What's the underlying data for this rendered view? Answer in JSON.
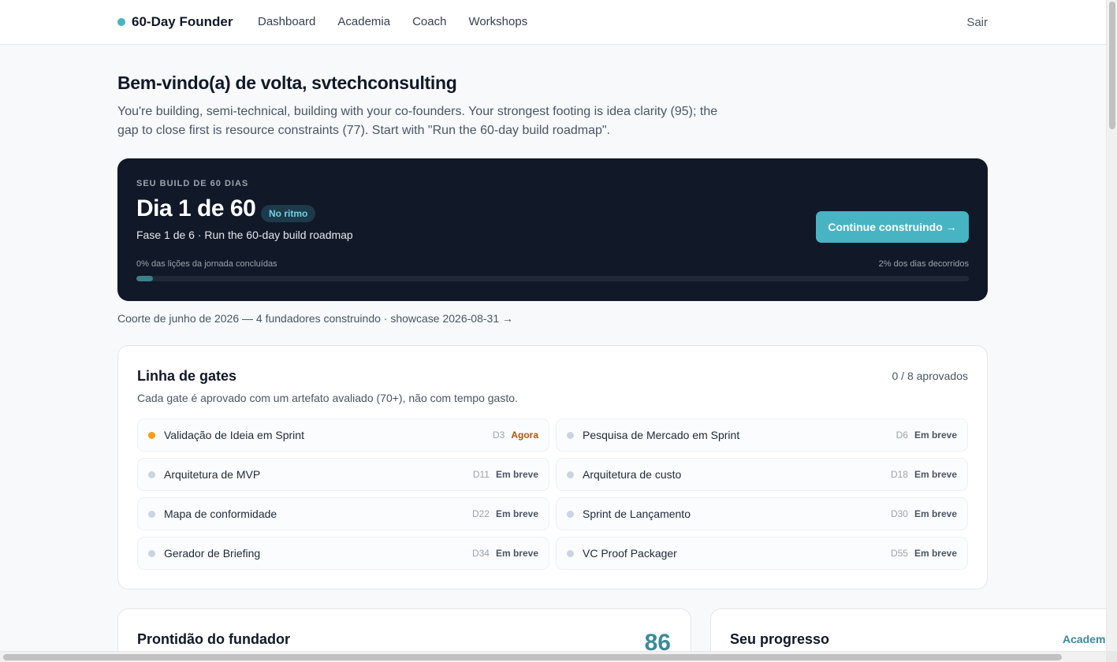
{
  "nav": {
    "brand": "60-Day Founder",
    "links": [
      "Dashboard",
      "Academia",
      "Coach",
      "Workshops"
    ],
    "logout": "Sair"
  },
  "welcome": {
    "title": "Bem-vindo(a) de volta, svtechconsulting",
    "text": "You're building, semi-technical, building with your co-founders. Your strongest footing is idea clarity (95); the gap to close first is resource constraints (77). Start with \"Run the 60-day build roadmap\"."
  },
  "build": {
    "eyebrow": "SEU BUILD DE 60 DIAS",
    "day": "Dia 1 de 60",
    "badge": "No ritmo",
    "phase": "Fase 1 de 6 · Run the 60-day build roadmap",
    "cta": "Continue construindo →",
    "lessons_progress": "0% das lições da jornada concluídas",
    "days_progress": "2% dos dias decorridos",
    "days_elapsed_fraction": 0.02
  },
  "cohort": "Coorte de junho de 2026 — 4 fundadores construindo · showcase 2026-08-31 →",
  "gates": {
    "title": "Linha de gates",
    "count": "0 / 8 aprovados",
    "subtitle": "Cada gate é aprovado com um artefato avaliado (70+), não com tempo gasto.",
    "items": [
      {
        "name": "Validação de Ideia em Sprint",
        "day": "D3",
        "status": "Agora"
      },
      {
        "name": "Pesquisa de Mercado em Sprint",
        "day": "D6",
        "status": "Em breve"
      },
      {
        "name": "Arquitetura de MVP",
        "day": "D11",
        "status": "Em breve"
      },
      {
        "name": "Arquitetura de custo",
        "day": "D18",
        "status": "Em breve"
      },
      {
        "name": "Mapa de conformidade",
        "day": "D22",
        "status": "Em breve"
      },
      {
        "name": "Sprint de Lançamento",
        "day": "D30",
        "status": "Em breve"
      },
      {
        "name": "Gerador de Briefing",
        "day": "D34",
        "status": "Em breve"
      },
      {
        "name": "VC Proof Packager",
        "day": "D55",
        "status": "Em breve"
      }
    ]
  },
  "readiness": {
    "title": "Prontidão do fundador",
    "score": "86"
  },
  "progress": {
    "title": "Seu progresso",
    "link": "Academia"
  },
  "colors": {
    "accent": "#47b4c3",
    "dark_card": "#111827",
    "gate_active": "#f59e0b",
    "gate_idle": "#cbd5e1"
  }
}
